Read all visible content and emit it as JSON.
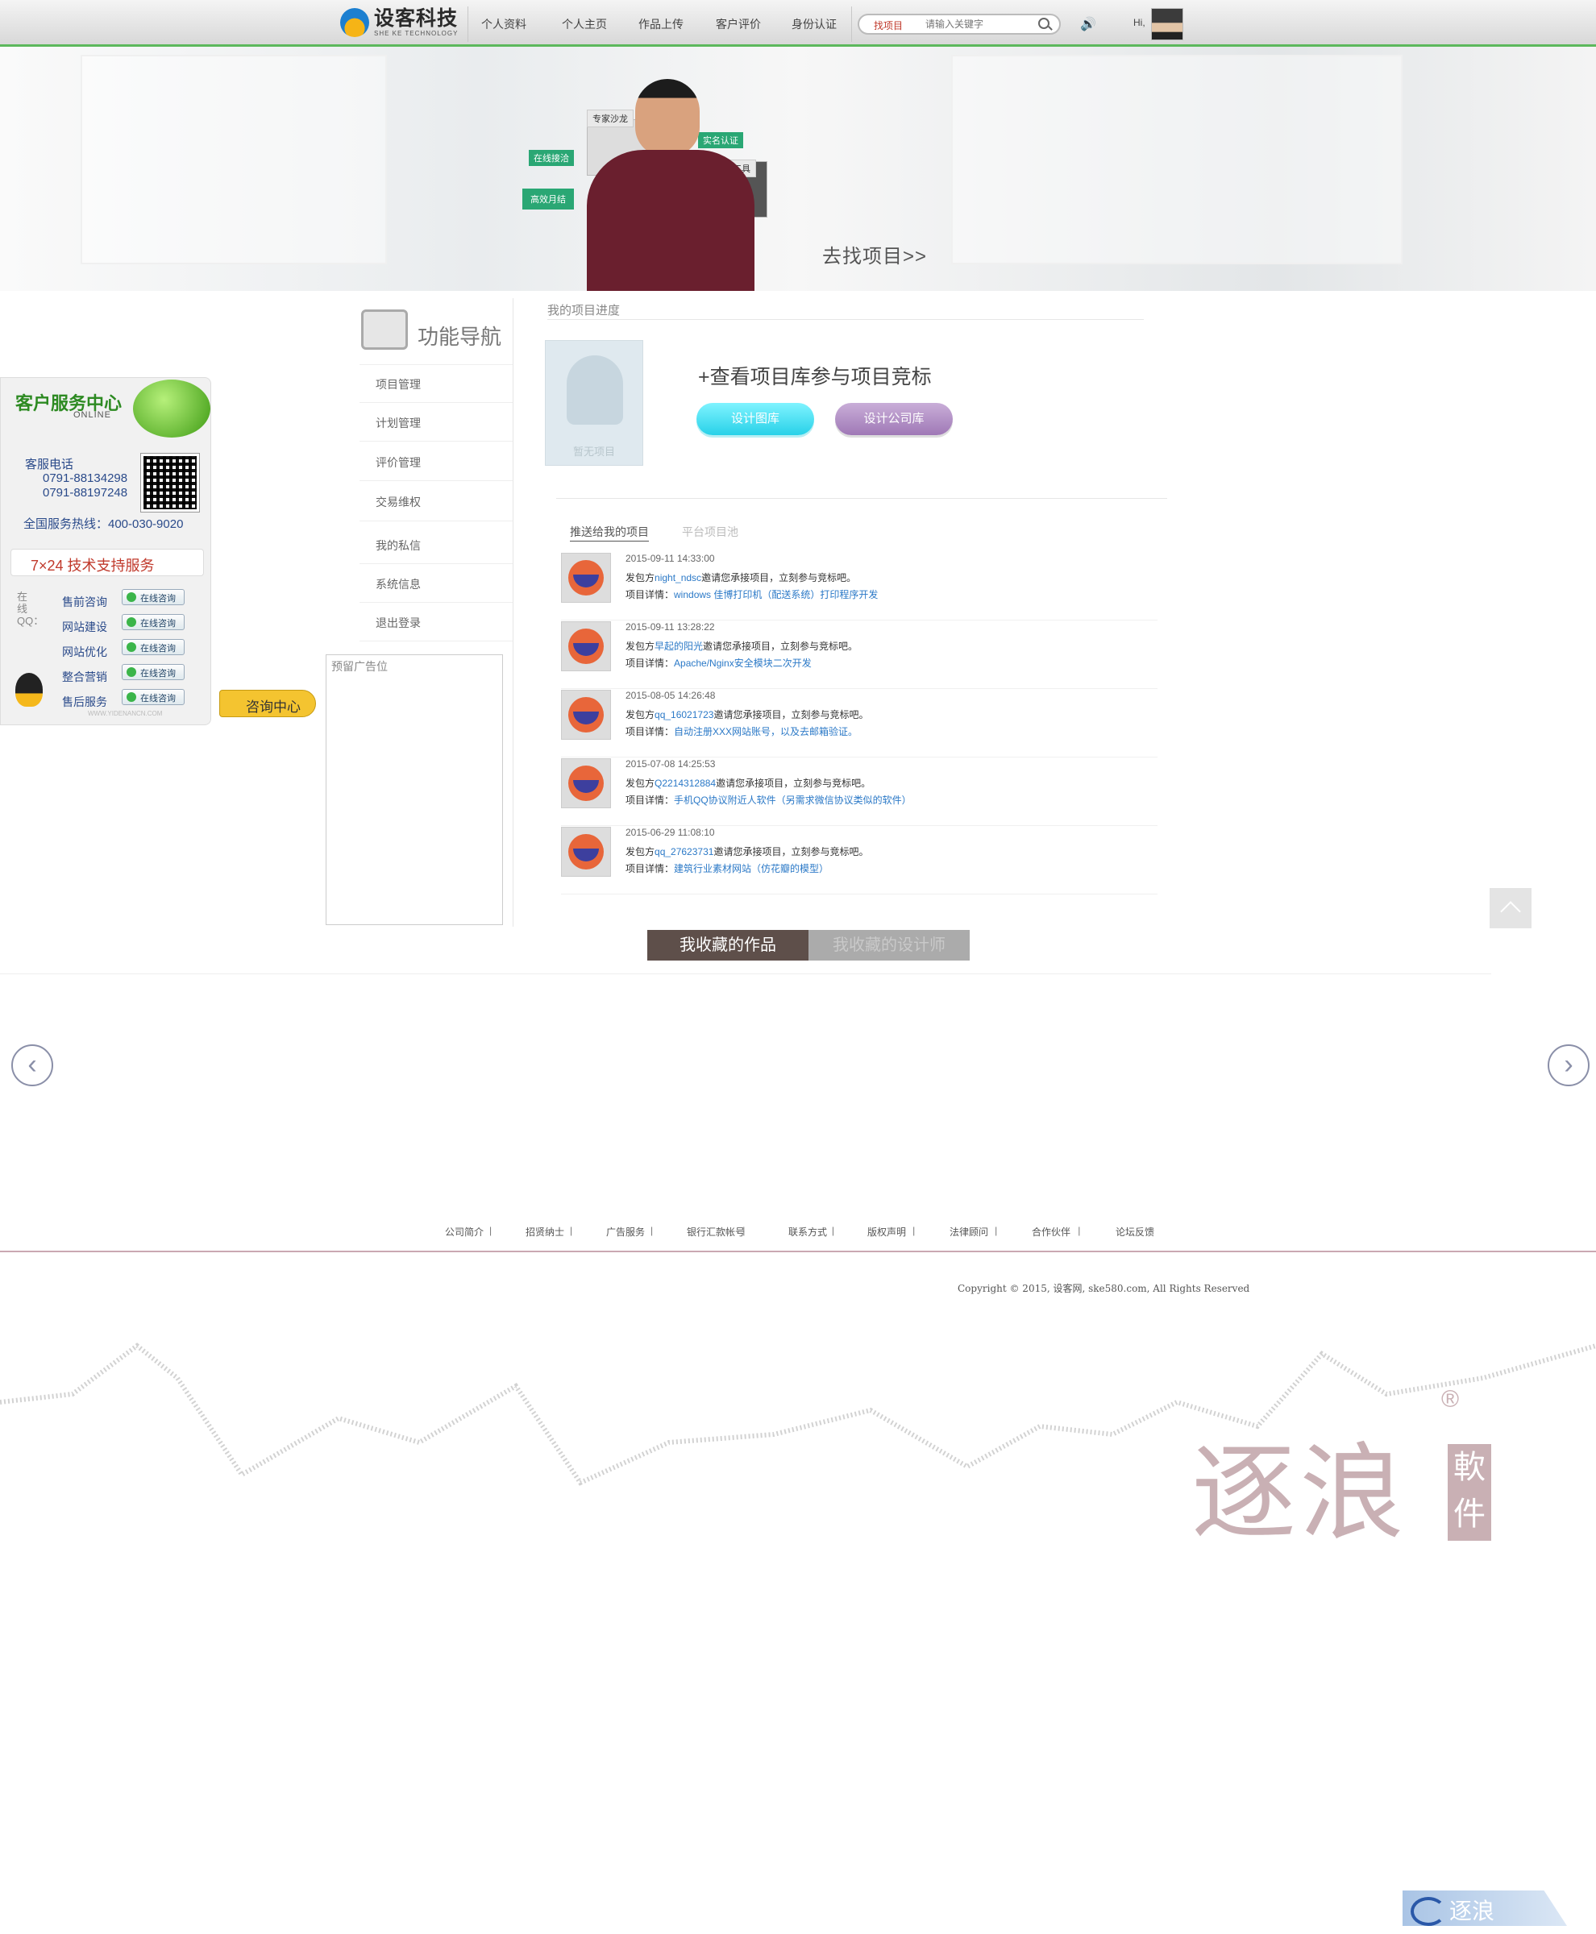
{
  "header": {
    "logo_cn": "设客科技",
    "logo_en": "SHE KE TECHNOLOGY",
    "nav": [
      "个人资料",
      "个人主页",
      "作品上传",
      "客户评价",
      "身份认证"
    ],
    "search_type": "找项目",
    "search_placeholder": "请输入关键字",
    "greeting": "Hi,"
  },
  "banner": {
    "tags": {
      "salon": "专家沙龙",
      "online": "在线接洽",
      "verified": "实名认证",
      "tools": "应用工具",
      "monthly": "高效月结"
    },
    "cta": "去找项目>>"
  },
  "service": {
    "title": "客户服务中心",
    "online": "ONLINE",
    "phone_label": "客服电话",
    "phones": [
      "0791-88134298",
      "0791-88197248"
    ],
    "hotline": "全国服务热线：400-030-9020",
    "support": "7×24 技术支持服务",
    "vertical": "在线QQ：",
    "items": [
      "售前咨询",
      "网站建设",
      "网站优化",
      "整合营销",
      "售后服务"
    ],
    "btn": "在线咨询",
    "url": "WWW.YIDENANCN.COM",
    "consult": "咨询中心"
  },
  "funcnav": {
    "title": "功能导航",
    "items": [
      "项目管理",
      "计划管理",
      "评价管理",
      "交易维权",
      "我的私信",
      "系统信息",
      "退出登录"
    ],
    "ad": "预留广告位"
  },
  "main": {
    "progress_title": "我的项目进度",
    "no_project": "暂无项目",
    "view_lib": "+查看项目库参与项目竞标",
    "btn_design": "设计图库",
    "btn_company": "设计公司库",
    "tab_push": "推送给我的项目",
    "tab_pool": "平台项目池",
    "invite_prefix": "发包方",
    "invite_suffix": "邀请您承接项目，立刻参与竞标吧。",
    "detail_prefix": "项目详情：",
    "projects": [
      {
        "time": "2015-09-11 14:33:00",
        "client": "night_ndsc",
        "detail": "windows 佳博打印机（配送系统）打印程序开发"
      },
      {
        "time": "2015-09-11 13:28:22",
        "client": "早起的阳光",
        "detail": "Apache/Nginx安全模块二次开发"
      },
      {
        "time": "2015-08-05 14:26:48",
        "client": "qq_16021723",
        "detail": "自动注册XXX网站账号，以及去邮箱验证。"
      },
      {
        "time": "2015-07-08 14:25:53",
        "client": "Q2214312884",
        "detail": "手机QQ协议附近人软件（另需求微信协议类似的软件）"
      },
      {
        "time": "2015-06-29 11:08:10",
        "client": "qq_27623731",
        "detail": "建筑行业素材网站（仿花瓣的模型）"
      }
    ]
  },
  "favorites": {
    "tab_works": "我收藏的作品",
    "tab_designers": "我收藏的设计师"
  },
  "footer": {
    "links": [
      "公司简介",
      "招贤纳士",
      "广告服务",
      "银行汇款帐号",
      "联系方式",
      "版权声明",
      "法律顾问",
      "合作伙伴",
      "论坛反馈"
    ],
    "copyright": "Copyright © 2015, 设客网, ske580.com, All Rights Reserved"
  },
  "watermark": {
    "brand": "逐浪",
    "box": "軟件",
    "reg": "®",
    "corner": "逐浪"
  }
}
